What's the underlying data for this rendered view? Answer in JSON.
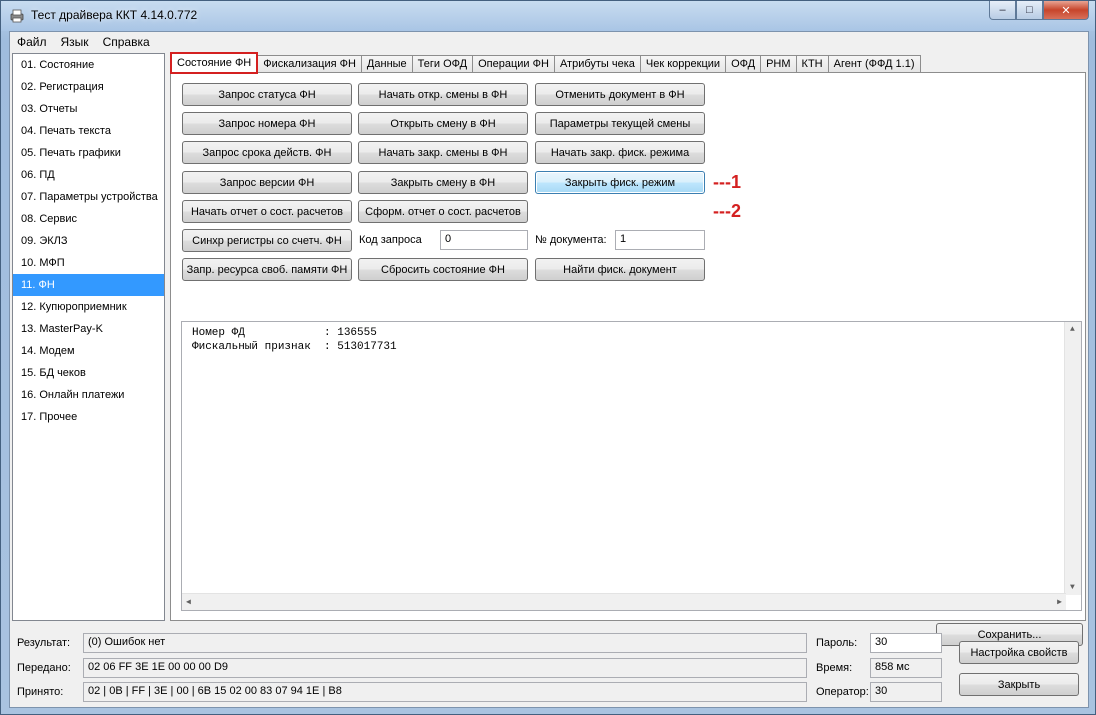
{
  "window": {
    "title": "Тест драйвера ККТ 4.14.0.772",
    "controls": {
      "minimize": "–",
      "maximize": "□",
      "close": "✕"
    }
  },
  "menu": [
    "Файл",
    "Язык",
    "Справка"
  ],
  "sidebar": {
    "items": [
      "01. Состояние",
      "02. Регистрация",
      "03. Отчеты",
      "04. Печать текста",
      "05. Печать графики",
      "06. ПД",
      "07. Параметры устройства",
      "08. Сервис",
      "09. ЭКЛЗ",
      "10. МФП",
      "11. ФН",
      "12. Купюроприемник",
      "13. MasterPay-K",
      "14. Модем",
      "15. БД чеков",
      "16. Онлайн платежи",
      "17. Прочее"
    ],
    "selected": "11. ФН"
  },
  "tabs": [
    "Состояние ФН",
    "Фискализация ФН",
    "Данные",
    "Теги ОФД",
    "Операции ФН",
    "Атрибуты чека",
    "Чек коррекции",
    "ОФД",
    "РНМ",
    "КТН",
    "Агент (ФФД 1.1)"
  ],
  "active_tab": "Состояние ФН",
  "buttons": {
    "col1": [
      "Запрос статуса ФН",
      "Запрос номера ФН",
      "Запрос срока действ. ФН",
      "Запрос версии ФН",
      "Начать отчет о сост. расчетов",
      "Синхр регистры со счетч. ФН",
      "Запр. ресурса своб. памяти ФН"
    ],
    "col2": [
      "Начать откр. смены в ФН",
      "Открыть смену в ФН",
      "Начать закр. смены в ФН",
      "Закрыть смену в ФН",
      "Сформ. отчет о сост. расчетов",
      "Сбросить состояние ФН"
    ],
    "col3": [
      "Отменить документ в ФН",
      "Параметры текущей смены",
      "Начать закр. фиск. режима",
      "Закрыть фиск. режим",
      "Найти фиск. документ"
    ],
    "save": "Сохранить...",
    "settings": "Настройка свойств",
    "close": "Закрыть"
  },
  "fields": {
    "request_code_label": "Код запроса",
    "request_code_value": "0",
    "doc_number_label": "№ документа:",
    "doc_number_value": "1"
  },
  "annotations": [
    "---1",
    "---2"
  ],
  "output": {
    "lines": [
      "Номер ФД            : 136555",
      "Фискальный признак  : 513017731"
    ]
  },
  "status": {
    "result_label": "Результат:",
    "result_value": "(0) Ошибок нет",
    "sent_label": "Передано:",
    "sent_value": "02 06 FF 3E 1E 00 00 00 D9",
    "received_label": "Принято:",
    "received_value": "02 | 0B | FF | 3E | 00 | 6B 15 02 00 83 07 94 1E | B8",
    "password_label": "Пароль:",
    "password_value": "30",
    "time_label": "Время:",
    "time_value": "858 мс",
    "operator_label": "Оператор:",
    "operator_value": "30"
  },
  "colors": {
    "selection": "#3399ff",
    "annotation_red": "#d42020",
    "focused_button": "#bee6fd"
  }
}
